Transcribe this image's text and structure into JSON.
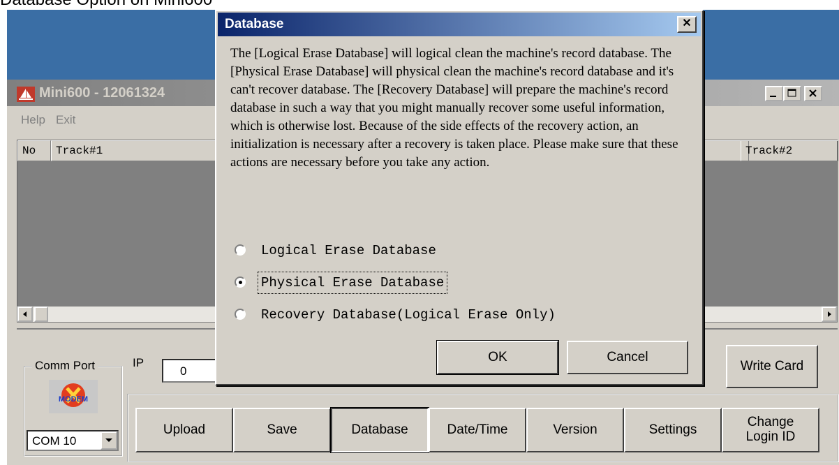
{
  "caption": "Database Option on Mini600",
  "main_window": {
    "title": "Mini600 - 12061324",
    "menu": [
      "Help",
      "Exit"
    ],
    "columns": [
      "No",
      "Track#1",
      "Track#2"
    ],
    "comm_port_label": "Comm Port",
    "modem_label": "MODEM",
    "com_value": "COM 10",
    "ip_label": "IP",
    "ip_value": "0",
    "write_card": "Write Card",
    "buttons": [
      "Upload",
      "Save",
      "Database",
      "Date/Time",
      "Version",
      "Settings",
      "Change Login ID"
    ]
  },
  "dialog": {
    "title": "Database",
    "close_symbol": "✕",
    "message": "The [Logical Erase Database] will logical clean the machine's record database.  The [Physical Erase Database] will physical clean the machine's record database and it's can't recover database.  The [Recovery Database] will prepare the machine's record database in such a way that you might manually recover some useful information, which is otherwise lost.  Because of the side effects of the recovery action, an initialization is necessary after a recovery is taken place.  Please make sure that these actions are necessary before you take any action.",
    "options": [
      "Logical Erase Database",
      "Physical Erase Database",
      "Recovery Database(Logical Erase Only)"
    ],
    "selected_option": "Physical Erase Database",
    "ok_label": "OK",
    "cancel_label": "Cancel"
  },
  "colors": {
    "dialog_title_start": "#0a246a",
    "dialog_title_end": "#a6caf0",
    "window_face": "#d4d0c8",
    "desktop": "#3a6ea5"
  }
}
